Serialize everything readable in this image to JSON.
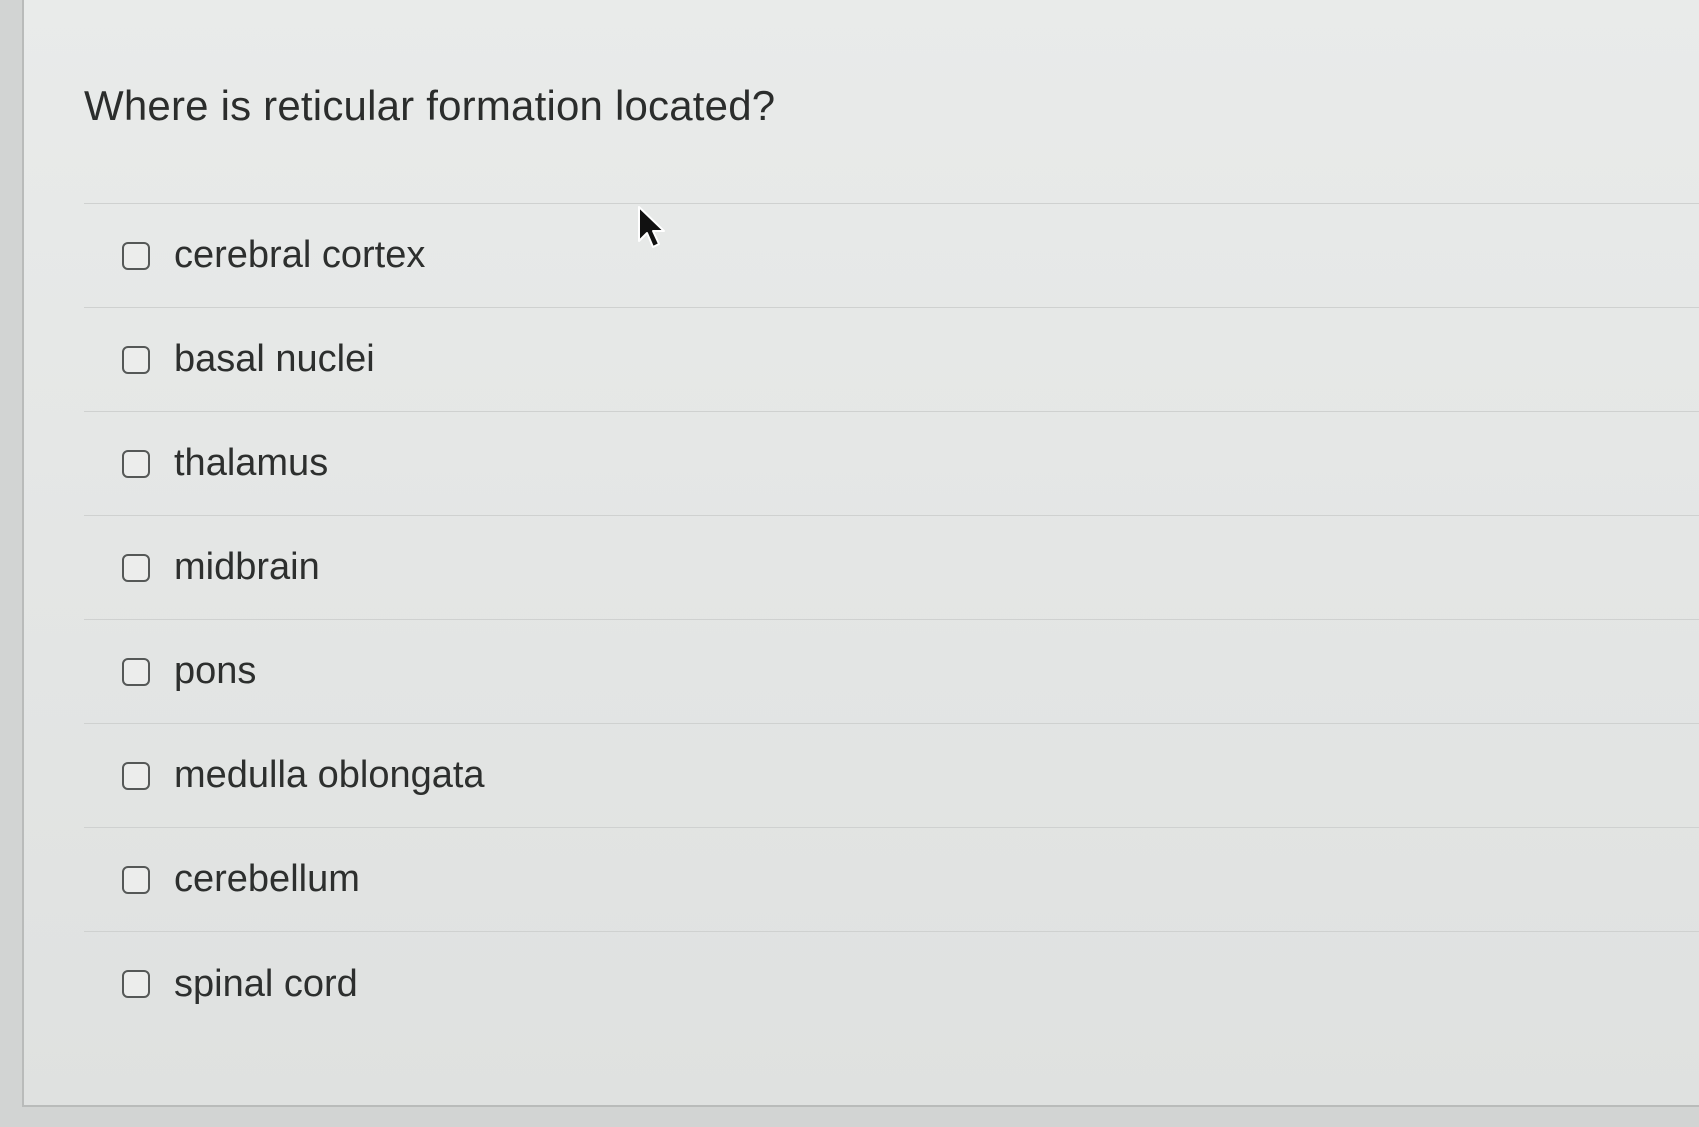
{
  "question": {
    "text": "Where is reticular formation located?"
  },
  "options": [
    {
      "label": "cerebral cortex",
      "checked": false
    },
    {
      "label": "basal nuclei",
      "checked": false
    },
    {
      "label": "thalamus",
      "checked": false
    },
    {
      "label": "midbrain",
      "checked": false
    },
    {
      "label": "pons",
      "checked": false
    },
    {
      "label": "medulla oblongata",
      "checked": false
    },
    {
      "label": "cerebellum",
      "checked": false
    },
    {
      "label": "spinal cord",
      "checked": false
    }
  ],
  "cursor": {
    "icon": "arrow-pointer-icon"
  }
}
